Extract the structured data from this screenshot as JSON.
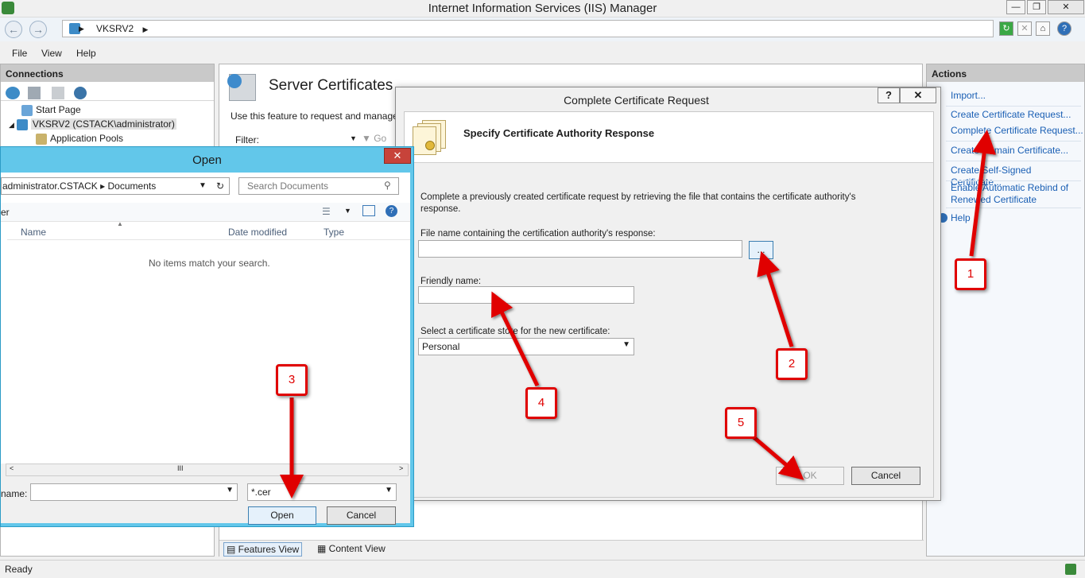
{
  "window": {
    "title": "Internet Information Services (IIS) Manager"
  },
  "address": {
    "path": "VKSRV2"
  },
  "menu": [
    "File",
    "View",
    "Help"
  ],
  "connections": {
    "header": "Connections",
    "tree": [
      "Start Page",
      "VKSRV2 (CSTACK\\administrator)",
      "Application Pools"
    ]
  },
  "center": {
    "title": "Server Certificates",
    "description": "Use this feature to request and manage",
    "filter_label": "Filter:",
    "go_label": "Go",
    "features_view": "Features View",
    "content_view": "Content View"
  },
  "actions": {
    "header": "Actions",
    "items": [
      "Import...",
      "Create Certificate Request...",
      "Complete Certificate Request...",
      "Create Domain Certificate...",
      "Create Self-Signed Certificate...",
      "Enable Automatic Rebind of Renewed Certificate",
      "Help"
    ]
  },
  "status": {
    "text": "Ready"
  },
  "cert_dialog": {
    "title": "Complete Certificate Request",
    "help_label": "?",
    "close_label": "✕",
    "heading": "Specify Certificate Authority Response",
    "intro": "Complete a previously created certificate request by retrieving the file that contains the certificate authority's response.",
    "file_label": "File name containing the certification authority's response:",
    "file_value": "",
    "browse_label": "...",
    "friendly_label": "Friendly name:",
    "friendly_value": "",
    "store_label": "Select a certificate store for the new certificate:",
    "store_value": "Personal",
    "ok_label": "OK",
    "cancel_label": "Cancel"
  },
  "open_dialog": {
    "title": "Open",
    "close_label": "✕",
    "path": "administrator.CSTACK ▸ Documents",
    "search_placeholder": "Search Documents",
    "toolbar_left": "er",
    "columns": [
      "Name",
      "Date modified",
      "Type"
    ],
    "empty_message": "No items match your search.",
    "filename_label": "name:",
    "filename_value": "",
    "filter_value": "*.cer",
    "open_label": "Open",
    "cancel_label": "Cancel"
  },
  "annotations": [
    "1",
    "2",
    "3",
    "4",
    "5"
  ],
  "colors": {
    "annotation": "#e00000",
    "link": "#1a5fb4",
    "open_dialog_frame": "#62c7ea"
  }
}
